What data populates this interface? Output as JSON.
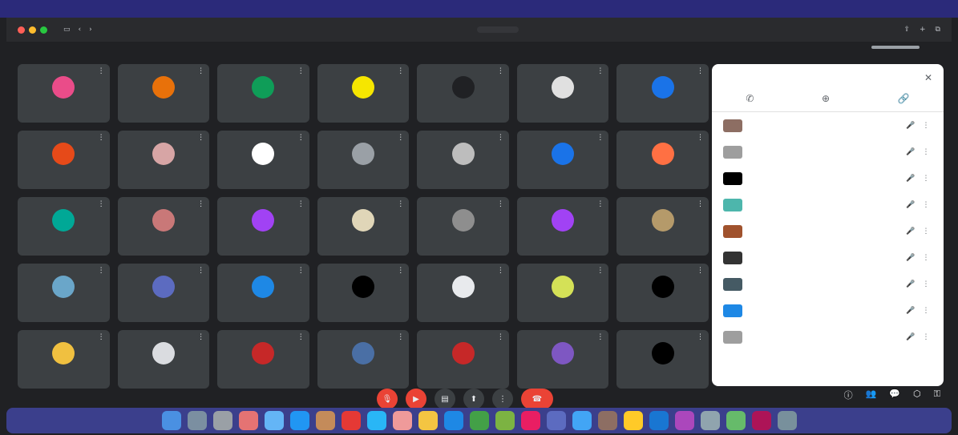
{
  "colors": {
    "accent": "#ea4335",
    "panel_bg": "#ffffff",
    "tile_bg": "#3c4043",
    "dock_bg": "#3b3f8c"
  },
  "menubar": {
    "left": [
      "",
      "",
      "",
      "",
      "",
      "",
      ""
    ],
    "right": [
      "",
      "",
      "",
      "",
      ""
    ]
  },
  "browser": {
    "url": "",
    "tab_title": ""
  },
  "tiles": [
    {
      "name": "",
      "color": "#ea4c89"
    },
    {
      "name": "",
      "color": "#e8710a"
    },
    {
      "name": "",
      "color": "#0f9d58"
    },
    {
      "name": "",
      "color": "#f6e600"
    },
    {
      "name": "",
      "color": "#202124"
    },
    {
      "name": "",
      "color": "#e0e0e0"
    },
    {
      "name": "",
      "color": "#1a73e8"
    },
    {
      "name": "",
      "color": "#e64a19"
    },
    {
      "name": "",
      "color": "#d7a5a5"
    },
    {
      "name": "",
      "color": "#ffffff"
    },
    {
      "name": "",
      "color": "#9aa0a6"
    },
    {
      "name": "",
      "color": "#bdbdbd"
    },
    {
      "name": "",
      "color": "#1a73e8"
    },
    {
      "name": "",
      "color": "#ff7043"
    },
    {
      "name": "",
      "color": "#00a896"
    },
    {
      "name": "",
      "color": "#c97878"
    },
    {
      "name": "",
      "color": "#a142f4"
    },
    {
      "name": "",
      "color": "#e0d6b8"
    },
    {
      "name": "",
      "color": "#8e8e8e"
    },
    {
      "name": "",
      "color": "#a142f4"
    },
    {
      "name": "",
      "color": "#b59a6a"
    },
    {
      "name": "",
      "color": "#6aa6c9"
    },
    {
      "name": "",
      "color": "#5c6bc0"
    },
    {
      "name": "",
      "color": "#1e88e5"
    },
    {
      "name": "",
      "color": "#000000"
    },
    {
      "name": "",
      "color": "#e8eaed"
    },
    {
      "name": "",
      "color": "#d4e157"
    },
    {
      "name": "",
      "color": "#000000"
    },
    {
      "name": "",
      "color": "#f0c040"
    },
    {
      "name": "",
      "color": "#dadce0"
    },
    {
      "name": "",
      "color": "#c62828"
    },
    {
      "name": "",
      "color": "#4a6fa5"
    },
    {
      "name": "",
      "color": "#c62828"
    },
    {
      "name": "",
      "color": "#7e57c2"
    },
    {
      "name": "",
      "color": "#000000"
    }
  ],
  "panel": {
    "title": "",
    "actions": [
      {
        "label": "",
        "icon": "phone-icon"
      },
      {
        "label": "",
        "icon": "add-people-icon"
      },
      {
        "label": "",
        "icon": "link-icon"
      }
    ],
    "people": [
      {
        "name": "",
        "color": "#8d6e63"
      },
      {
        "name": "",
        "color": "#9e9e9e"
      },
      {
        "name": "",
        "color": "#000000"
      },
      {
        "name": "",
        "color": "#4db6ac"
      },
      {
        "name": "",
        "color": "#a0522d"
      },
      {
        "name": "",
        "color": "#333333"
      },
      {
        "name": "",
        "color": "#455a64"
      },
      {
        "name": "",
        "color": "#1e88e5"
      },
      {
        "name": "",
        "color": "#9e9e9e"
      }
    ]
  },
  "bottom": {
    "meeting_info": ""
  },
  "dock": {
    "apps": [
      "#4a90e2",
      "#7b8fa1",
      "#9aa0a6",
      "#e57373",
      "#64b5f6",
      "#2196f3",
      "#c48b5a",
      "#e53935",
      "#29b6f6",
      "#ef9a9a",
      "#f4c542",
      "#1e88e5",
      "#43a047",
      "#7cb342",
      "#e91e63",
      "#5c6bc0",
      "#42a5f5",
      "#8d6e63",
      "#ffca28",
      "#1976d2",
      "#ab47bc",
      "#90a4ae",
      "#66bb6a",
      "#ad1457",
      "#78909c"
    ]
  }
}
